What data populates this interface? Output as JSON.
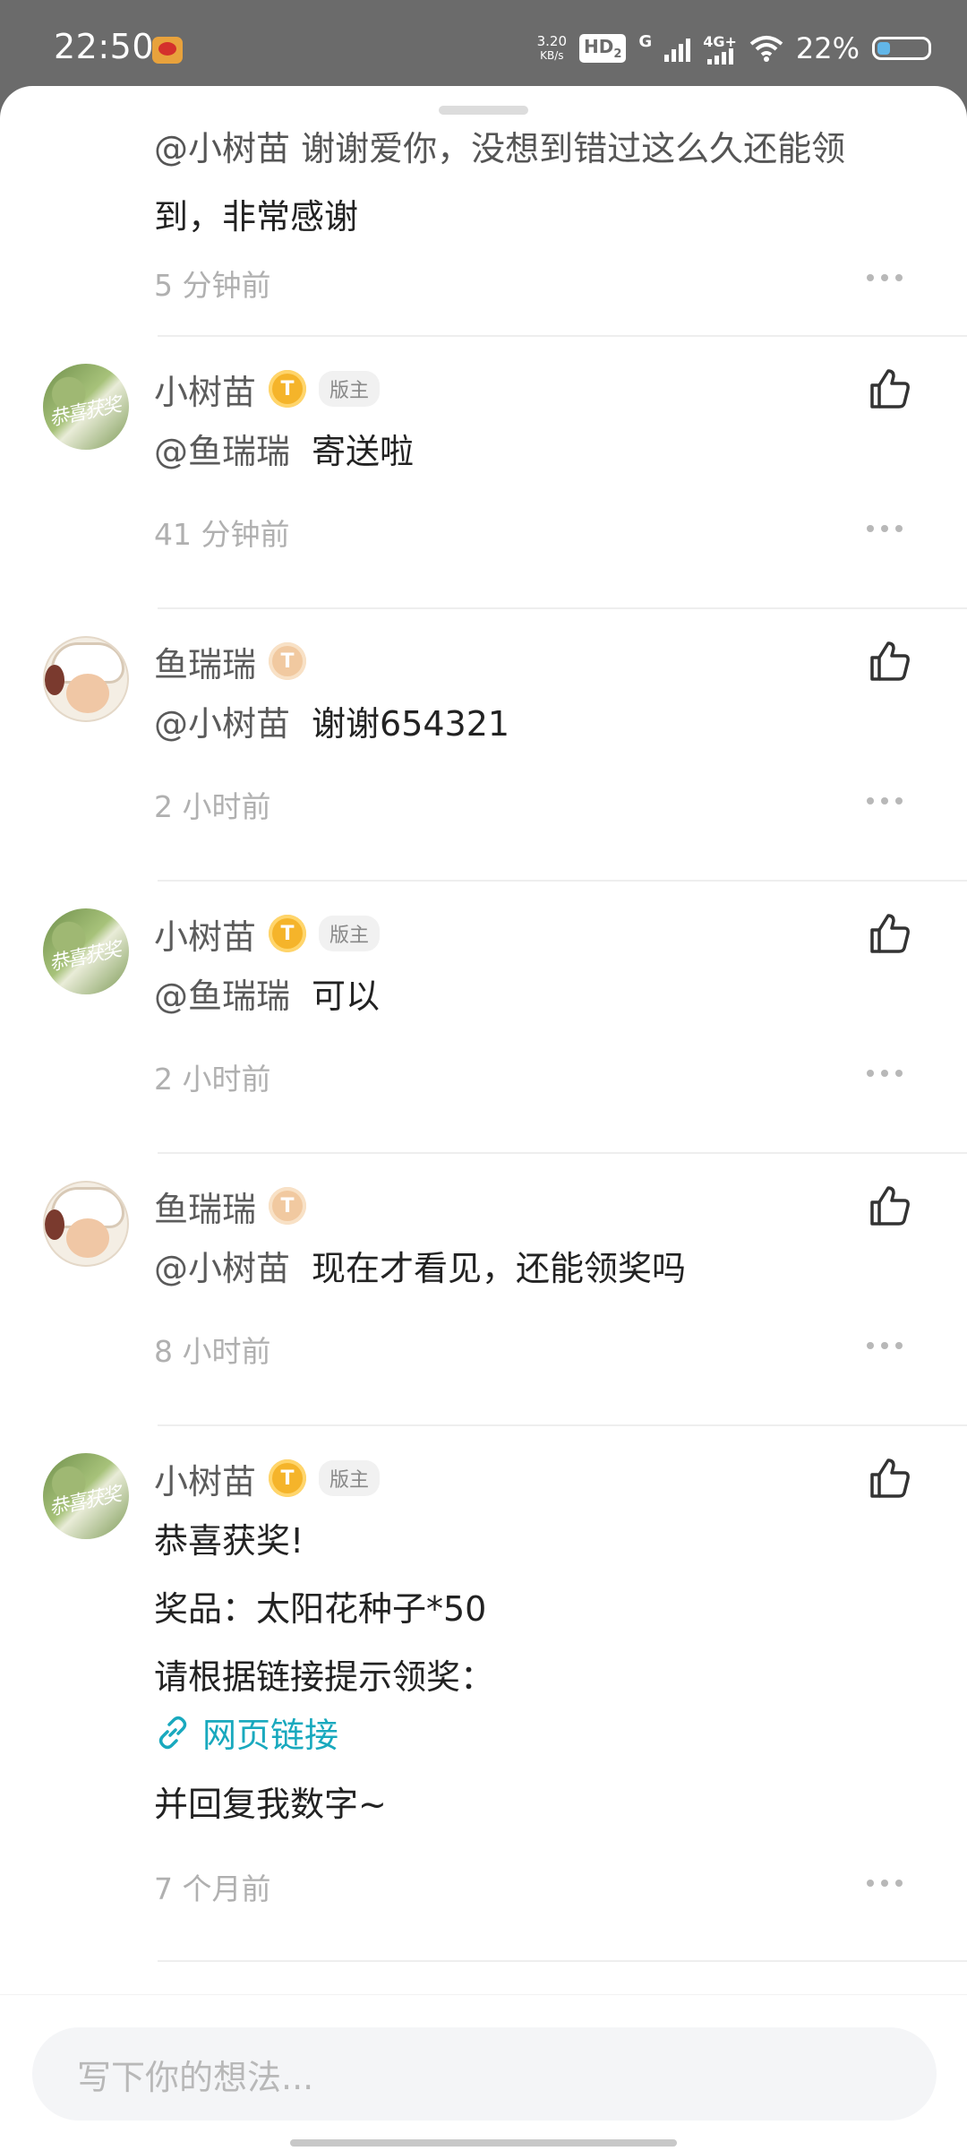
{
  "status_bar": {
    "time": "22:50",
    "net_speed_value": "3.20",
    "net_speed_unit": "KB/s",
    "hd": "HD",
    "hd_sub": "2",
    "g": "G",
    "lte": "4G+",
    "battery": "22%"
  },
  "partial_comment": {
    "text_line1": "@小树苗  谢谢爱你，没想到错过这么久还能领",
    "text_line2": "到，非常感谢",
    "time": "5 分钟前"
  },
  "comments": [
    {
      "user": "小树苗",
      "level": "T",
      "mod": "版主",
      "mention": "@鱼瑞瑞",
      "text": "寄送啦",
      "time": "41 分钟前"
    },
    {
      "user": "鱼瑞瑞",
      "level": "T",
      "mention": "@小树苗",
      "text": "谢谢654321",
      "time": "2 小时前"
    },
    {
      "user": "小树苗",
      "level": "T",
      "mod": "版主",
      "mention": "@鱼瑞瑞",
      "text": "可以",
      "time": "2 小时前"
    },
    {
      "user": "鱼瑞瑞",
      "level": "T",
      "mention": "@小树苗",
      "text": "现在才看见，还能领奖吗",
      "time": "8 小时前"
    }
  ],
  "main_post": {
    "user": "小树苗",
    "level": "T",
    "mod": "版主",
    "line1": "恭喜获奖!",
    "line2": "奖品：太阳花种子*50",
    "line3": "请根据链接提示领奖：",
    "link_text": "网页链接",
    "line4": "并回复我数字~",
    "time": "7 个月前"
  },
  "input": {
    "placeholder": "写下你的想法..."
  },
  "colors": {
    "link": "#19a9be",
    "gold_level": "#f5b42a",
    "pale_level": "#f1c9a0"
  }
}
